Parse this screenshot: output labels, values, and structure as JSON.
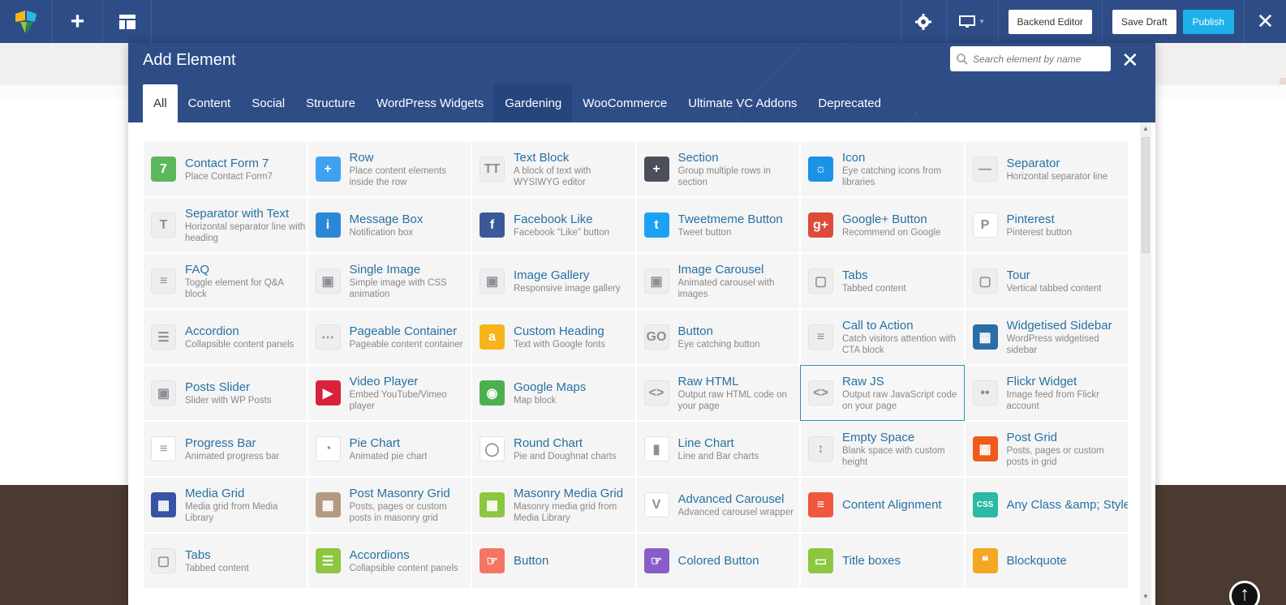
{
  "topbar": {
    "backend_editor": "Backend Editor",
    "save_draft": "Save Draft",
    "publish": "Publish",
    "close": "✕"
  },
  "modal": {
    "title": "Add Element",
    "search_placeholder": "Search element by name",
    "close": "✕",
    "tabs": [
      {
        "label": "All"
      },
      {
        "label": "Content"
      },
      {
        "label": "Social"
      },
      {
        "label": "Structure"
      },
      {
        "label": "WordPress Widgets"
      },
      {
        "label": "Gardening"
      },
      {
        "label": "WooCommerce"
      },
      {
        "label": "Ultimate VC Addons"
      },
      {
        "label": "Deprecated"
      }
    ]
  },
  "elements": [
    {
      "name": "Contact Form 7",
      "desc": "Place Contact Form7",
      "icon": "contact-form-7-icon",
      "color": "#5cb85c",
      "glyph": "7"
    },
    {
      "name": "Row",
      "desc": "Place content elements inside the row",
      "icon": "row-icon",
      "color": "#3ea1f1",
      "glyph": "+"
    },
    {
      "name": "Text Block",
      "desc": "A block of text with WYSIWYG editor",
      "icon": "text-block-icon",
      "color": "#eeeeee",
      "glyph": "TT"
    },
    {
      "name": "Section",
      "desc": "Group multiple rows in section",
      "icon": "section-icon",
      "color": "#4b4f5a",
      "glyph": "+"
    },
    {
      "name": "Icon",
      "desc": "Eye catching icons from libraries",
      "icon": "icon-element-icon",
      "color": "#1b91e8",
      "glyph": "☼"
    },
    {
      "name": "Separator",
      "desc": "Horizontal separator line",
      "icon": "separator-icon",
      "color": "#eeeeee",
      "glyph": "—"
    },
    {
      "name": "Separator with Text",
      "desc": "Horizontal separator line with heading",
      "icon": "separator-text-icon",
      "color": "#eeeeee",
      "glyph": "T"
    },
    {
      "name": "Message Box",
      "desc": "Notification box",
      "icon": "message-box-icon",
      "color": "#2b88d9",
      "glyph": "i"
    },
    {
      "name": "Facebook Like",
      "desc": "Facebook \"Like\" button",
      "icon": "facebook-icon",
      "color": "#3b5998",
      "glyph": "f"
    },
    {
      "name": "Tweetmeme Button",
      "desc": "Tweet button",
      "icon": "twitter-icon",
      "color": "#1da1f2",
      "glyph": "t"
    },
    {
      "name": "Google+ Button",
      "desc": "Recommend on Google",
      "icon": "google-plus-icon",
      "color": "#dd4b39",
      "glyph": "g+"
    },
    {
      "name": "Pinterest",
      "desc": "Pinterest button",
      "icon": "pinterest-icon",
      "color": "#ffffff",
      "glyph": "P"
    },
    {
      "name": "FAQ",
      "desc": "Toggle element for Q&A block",
      "icon": "faq-icon",
      "color": "#eeeeee",
      "glyph": "≡"
    },
    {
      "name": "Single Image",
      "desc": "Simple image with CSS animation",
      "icon": "single-image-icon",
      "color": "#eeeeee",
      "glyph": "▣"
    },
    {
      "name": "Image Gallery",
      "desc": "Responsive image gallery",
      "icon": "image-gallery-icon",
      "color": "#eeeeee",
      "glyph": "▣"
    },
    {
      "name": "Image Carousel",
      "desc": "Animated carousel with images",
      "icon": "image-carousel-icon",
      "color": "#eeeeee",
      "glyph": "▣"
    },
    {
      "name": "Tabs",
      "desc": "Tabbed content",
      "icon": "tabs-icon",
      "color": "#eeeeee",
      "glyph": "▢"
    },
    {
      "name": "Tour",
      "desc": "Vertical tabbed content",
      "icon": "tour-icon",
      "color": "#eeeeee",
      "glyph": "▢"
    },
    {
      "name": "Accordion",
      "desc": "Collapsible content panels",
      "icon": "accordion-icon",
      "color": "#eeeeee",
      "glyph": "☰"
    },
    {
      "name": "Pageable Container",
      "desc": "Pageable content container",
      "icon": "pageable-container-icon",
      "color": "#eeeeee",
      "glyph": "⋯"
    },
    {
      "name": "Custom Heading",
      "desc": "Text with Google fonts",
      "icon": "custom-heading-icon",
      "color": "#f7b51b",
      "glyph": "a"
    },
    {
      "name": "Button",
      "desc": "Eye catching button",
      "icon": "button-icon",
      "color": "#eeeeee",
      "glyph": "GO"
    },
    {
      "name": "Call to Action",
      "desc": "Catch visitors attention with CTA block",
      "icon": "call-to-action-icon",
      "color": "#eeeeee",
      "glyph": "≡"
    },
    {
      "name": "Widgetised Sidebar",
      "desc": "WordPress widgetised sidebar",
      "icon": "widgetised-sidebar-icon",
      "color": "#2a6ea8",
      "glyph": "▦"
    },
    {
      "name": "Posts Slider",
      "desc": "Slider with WP Posts",
      "icon": "posts-slider-icon",
      "color": "#eeeeee",
      "glyph": "▣"
    },
    {
      "name": "Video Player",
      "desc": "Embed YouTube/Vimeo player",
      "icon": "video-player-icon",
      "color": "#d9213b",
      "glyph": "▶"
    },
    {
      "name": "Google Maps",
      "desc": "Map block",
      "icon": "google-maps-icon",
      "color": "#4caf50",
      "glyph": "◉"
    },
    {
      "name": "Raw HTML",
      "desc": "Output raw HTML code on your page",
      "icon": "raw-html-icon",
      "color": "#eeeeee",
      "glyph": "<>"
    },
    {
      "name": "Raw JS",
      "desc": "Output raw JavaScript code on your page",
      "icon": "raw-js-icon",
      "color": "#eeeeee",
      "glyph": "<>"
    },
    {
      "name": "Flickr Widget",
      "desc": "Image feed from Flickr account",
      "icon": "flickr-icon",
      "color": "#eeeeee",
      "glyph": "••"
    },
    {
      "name": "Progress Bar",
      "desc": "Animated progress bar",
      "icon": "progress-bar-icon",
      "color": "#ffffff",
      "glyph": "≡"
    },
    {
      "name": "Pie Chart",
      "desc": "Animated pie chart",
      "icon": "pie-chart-icon",
      "color": "#ffffff",
      "glyph": "◔"
    },
    {
      "name": "Round Chart",
      "desc": "Pie and Doughnat charts",
      "icon": "round-chart-icon",
      "color": "#ffffff",
      "glyph": "◯"
    },
    {
      "name": "Line Chart",
      "desc": "Line and Bar charts",
      "icon": "line-chart-icon",
      "color": "#ffffff",
      "glyph": "▮"
    },
    {
      "name": "Empty Space",
      "desc": "Blank space with custom height",
      "icon": "empty-space-icon",
      "color": "#eeeeee",
      "glyph": "↕"
    },
    {
      "name": "Post Grid",
      "desc": "Posts, pages or custom posts in grid",
      "icon": "post-grid-icon",
      "color": "#f05a1a",
      "glyph": "▦"
    },
    {
      "name": "Media Grid",
      "desc": "Media grid from Media Library",
      "icon": "media-grid-icon",
      "color": "#3953a4",
      "glyph": "▦"
    },
    {
      "name": "Post Masonry Grid",
      "desc": "Posts, pages or custom posts in masonry grid",
      "icon": "post-masonry-grid-icon",
      "color": "#b29b80",
      "glyph": "▦"
    },
    {
      "name": "Masonry Media Grid",
      "desc": "Masonry media grid from Media Library",
      "icon": "masonry-media-grid-icon",
      "color": "#8dc63f",
      "glyph": "▦"
    },
    {
      "name": "Advanced Carousel",
      "desc": "Advanced carousel wrapper",
      "icon": "advanced-carousel-icon",
      "color": "#ffffff",
      "glyph": "V"
    },
    {
      "name": "Content Alignment",
      "desc": "",
      "icon": "content-alignment-icon",
      "color": "#f0573e",
      "glyph": "≡"
    },
    {
      "name": "Any Class &amp; Style",
      "desc": "",
      "icon": "css-icon",
      "color": "#2bbaa4",
      "glyph": "CSS"
    },
    {
      "name": "Tabs",
      "desc": "Tabbed content",
      "icon": "tabs-alt-icon",
      "color": "#eeeeee",
      "glyph": "▢"
    },
    {
      "name": "Accordions",
      "desc": "Collapsible content panels",
      "icon": "accordions-icon",
      "color": "#8dc63f",
      "glyph": "☰"
    },
    {
      "name": "Button",
      "desc": "",
      "icon": "button-alt-icon",
      "color": "#f47564",
      "glyph": "☞"
    },
    {
      "name": "Colored Button",
      "desc": "",
      "icon": "colored-button-icon",
      "color": "#8a5cc9",
      "glyph": "☞"
    },
    {
      "name": "Title boxes",
      "desc": "",
      "icon": "title-boxes-icon",
      "color": "#8dc63f",
      "glyph": "▭"
    },
    {
      "name": "Blockquote",
      "desc": "",
      "icon": "blockquote-icon",
      "color": "#f5a623",
      "glyph": "❝"
    }
  ]
}
